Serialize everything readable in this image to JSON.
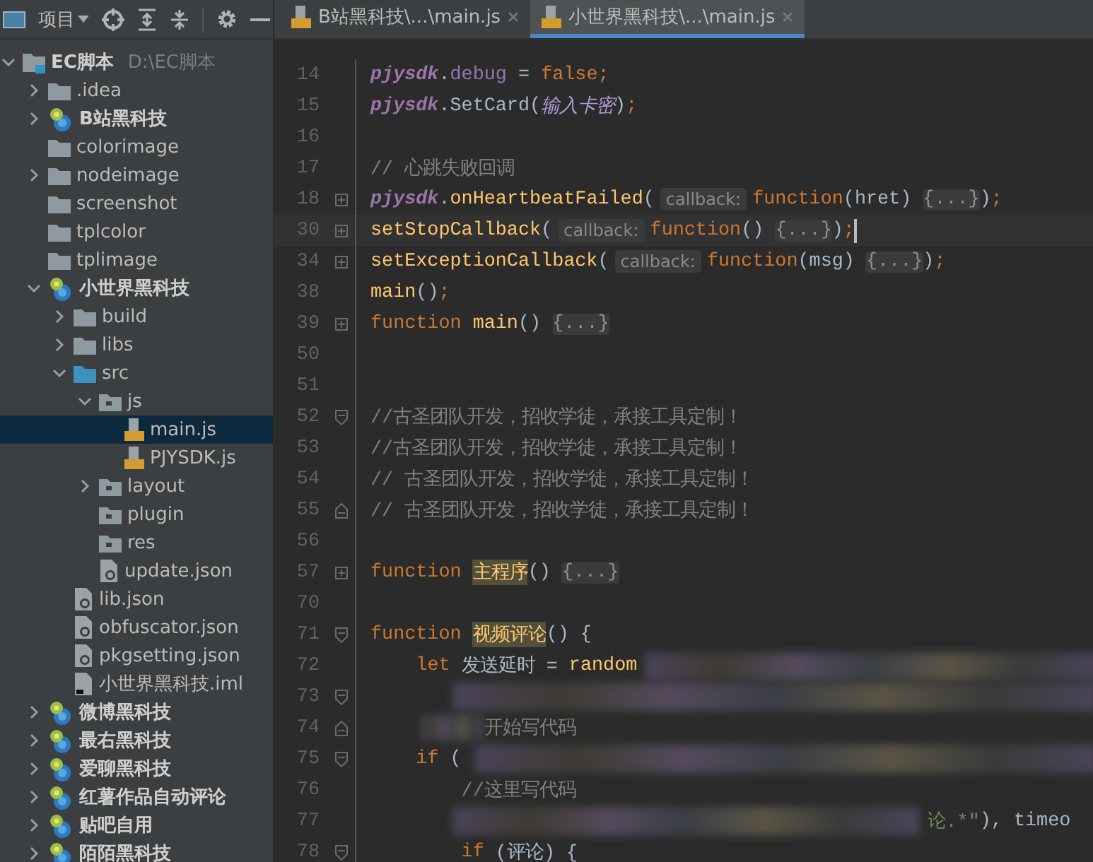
{
  "sidebar": {
    "toolbar": {
      "title": "项目"
    },
    "tree": [
      {
        "label": "EC脚本",
        "path": "D:\\EC脚本",
        "kind": "root",
        "expanded": true,
        "selected": false,
        "children": [
          {
            "label": ".idea",
            "kind": "folder",
            "expanded": false,
            "selected": false
          },
          {
            "label": "B站黑科技",
            "kind": "module",
            "expanded": false,
            "selected": false
          },
          {
            "label": "colorimage",
            "kind": "folder",
            "selected": false
          },
          {
            "label": "nodeimage",
            "kind": "folder",
            "expanded": false,
            "selected": false
          },
          {
            "label": "screenshot",
            "kind": "folder",
            "selected": false
          },
          {
            "label": "tplcolor",
            "kind": "folder",
            "selected": false
          },
          {
            "label": "tplimage",
            "kind": "folder",
            "selected": false
          },
          {
            "label": "小世界黑科技",
            "kind": "module",
            "expanded": true,
            "selected": false,
            "children": [
              {
                "label": "build",
                "kind": "folder",
                "expanded": false,
                "selected": false
              },
              {
                "label": "libs",
                "kind": "folder",
                "expanded": false,
                "selected": false
              },
              {
                "label": "src",
                "kind": "source",
                "expanded": true,
                "selected": false,
                "children": [
                  {
                    "label": "js",
                    "kind": "package",
                    "expanded": true,
                    "selected": false,
                    "children": [
                      {
                        "label": "main.js",
                        "kind": "js",
                        "selected": true
                      },
                      {
                        "label": "PJYSDK.js",
                        "kind": "js",
                        "selected": false
                      }
                    ]
                  },
                  {
                    "label": "layout",
                    "kind": "package",
                    "expanded": false,
                    "selected": false
                  },
                  {
                    "label": "plugin",
                    "kind": "package",
                    "selected": false
                  },
                  {
                    "label": "res",
                    "kind": "package",
                    "selected": false
                  },
                  {
                    "label": "update.json",
                    "kind": "json",
                    "selected": false
                  }
                ]
              },
              {
                "label": "lib.json",
                "kind": "json",
                "selected": false
              },
              {
                "label": "obfuscator.json",
                "kind": "json",
                "selected": false
              },
              {
                "label": "pkgsetting.json",
                "kind": "json",
                "selected": false
              },
              {
                "label": "小世界黑科技.iml",
                "kind": "iml",
                "selected": false
              }
            ]
          },
          {
            "label": "微博黑科技",
            "kind": "module",
            "expanded": false,
            "selected": false
          },
          {
            "label": "最右黑科技",
            "kind": "module",
            "expanded": false,
            "selected": false
          },
          {
            "label": "爱聊黑科技",
            "kind": "module",
            "expanded": false,
            "selected": false
          },
          {
            "label": "红薯作品自动评论",
            "kind": "module",
            "expanded": false,
            "selected": false
          },
          {
            "label": "贴吧自用",
            "kind": "module",
            "expanded": false,
            "selected": false
          },
          {
            "label": "陌陌黑科技",
            "kind": "module",
            "expanded": false,
            "selected": false
          }
        ]
      }
    ]
  },
  "tabs": [
    {
      "label": "B站黑科技\\...\\main.js",
      "selected": false
    },
    {
      "label": "小世界黑科技\\...\\main.js",
      "selected": true
    }
  ],
  "editor": {
    "redacted": true,
    "lines": [
      {
        "number": "14",
        "current": false,
        "tokens": [
          {
            "kind": "object",
            "text": "pjysdk"
          },
          {
            "kind": "plain",
            "text": "."
          },
          {
            "kind": "field",
            "text": "debug"
          },
          {
            "kind": "plain",
            "text": " = "
          },
          {
            "kind": "keyword",
            "text": "false;"
          }
        ]
      },
      {
        "number": "15",
        "current": false,
        "tokens": [
          {
            "kind": "object",
            "text": "pjysdk"
          },
          {
            "kind": "plain",
            "text": ".SetCard("
          },
          {
            "kind": "variable",
            "text": "输入卡密"
          },
          {
            "kind": "plain",
            "text": ")"
          },
          {
            "kind": "keyword",
            "text": ";"
          }
        ]
      },
      {
        "number": "16",
        "current": false
      },
      {
        "number": "17",
        "current": false,
        "tokens": [
          {
            "kind": "comment",
            "text": "// 心跳失败回调"
          }
        ]
      },
      {
        "number": "18",
        "current": false,
        "collapsed": true,
        "tokens": [
          {
            "kind": "object",
            "text": "pjysdk"
          },
          {
            "kind": "plain",
            "text": "."
          },
          {
            "kind": "function",
            "text": "onHeartbeatFailed"
          },
          {
            "kind": "plain",
            "text": "("
          },
          {
            "kind": "hint",
            "text": "callback:"
          },
          {
            "kind": "keyword",
            "text": "function"
          },
          {
            "kind": "plain",
            "text": "(hret) "
          },
          {
            "kind": "folded",
            "text": "{...}"
          },
          {
            "kind": "plain",
            "text": ")"
          },
          {
            "kind": "keyword",
            "text": ";"
          }
        ]
      },
      {
        "number": "30",
        "current": true,
        "collapsed": true,
        "tokens": [
          {
            "kind": "function",
            "text": "setStopCallback"
          },
          {
            "kind": "plain",
            "text": "("
          },
          {
            "kind": "hint",
            "text": "callback:"
          },
          {
            "kind": "keyword",
            "text": "function"
          },
          {
            "kind": "plain",
            "text": "() "
          },
          {
            "kind": "folded",
            "text": "{...}"
          },
          {
            "kind": "plain",
            "text": ")"
          },
          {
            "kind": "keyword",
            "text": ";"
          }
        ]
      },
      {
        "number": "34",
        "current": false,
        "collapsed": true,
        "tokens": [
          {
            "kind": "function",
            "text": "setExceptionCallback"
          },
          {
            "kind": "plain",
            "text": "("
          },
          {
            "kind": "hint",
            "text": "callback:"
          },
          {
            "kind": "keyword",
            "text": "function"
          },
          {
            "kind": "plain",
            "text": "(msg) "
          },
          {
            "kind": "folded",
            "text": "{...}"
          },
          {
            "kind": "plain",
            "text": ")"
          },
          {
            "kind": "keyword",
            "text": ";"
          }
        ]
      },
      {
        "number": "38",
        "current": false,
        "tokens": [
          {
            "kind": "function",
            "text": "main"
          },
          {
            "kind": "plain",
            "text": "()"
          },
          {
            "kind": "keyword",
            "text": ";"
          }
        ]
      },
      {
        "number": "39",
        "current": false,
        "collapsed": true,
        "tokens": [
          {
            "kind": "keyword",
            "text": "function "
          },
          {
            "kind": "function",
            "text": "main"
          },
          {
            "kind": "plain",
            "text": "() "
          },
          {
            "kind": "folded",
            "text": "{...}"
          }
        ]
      },
      {
        "number": "50",
        "current": false
      },
      {
        "number": "51",
        "current": false
      },
      {
        "number": "52",
        "current": false,
        "collapsed": false,
        "tokens": [
          {
            "kind": "comment",
            "text": "//古圣团队开发，招收学徒，承接工具定制！"
          }
        ]
      },
      {
        "number": "53",
        "current": false,
        "tokens": [
          {
            "kind": "comment",
            "text": "//古圣团队开发，招收学徒，承接工具定制！"
          }
        ]
      },
      {
        "number": "54",
        "current": false,
        "tokens": [
          {
            "kind": "comment",
            "text": "// 古圣团队开发，招收学徒，承接工具定制！"
          }
        ]
      },
      {
        "number": "55",
        "current": false,
        "fold_end": true,
        "tokens": [
          {
            "kind": "comment",
            "text": "// 古圣团队开发，招收学徒，承接工具定制！"
          }
        ]
      },
      {
        "number": "56",
        "current": false
      },
      {
        "number": "57",
        "current": false,
        "collapsed": true,
        "tokens": [
          {
            "kind": "keyword",
            "text": "function "
          },
          {
            "kind": "marked",
            "text": "主程序"
          },
          {
            "kind": "plain",
            "text": "() "
          },
          {
            "kind": "folded",
            "text": "{...}"
          }
        ]
      },
      {
        "number": "70",
        "current": false
      },
      {
        "number": "71",
        "current": false,
        "collapsed": false,
        "tokens": [
          {
            "kind": "keyword",
            "text": "function "
          },
          {
            "kind": "marked",
            "text": "视频评论"
          },
          {
            "kind": "plain",
            "text": "() {"
          }
        ]
      },
      {
        "number": "72",
        "current": false,
        "tokens": [
          {
            "kind": "keyword",
            "text": "    let "
          },
          {
            "kind": "plain",
            "text": "发送延时 = "
          },
          {
            "kind": "function",
            "text": "random"
          }
        ]
      },
      {
        "number": "73",
        "current": false,
        "collapsed": false
      },
      {
        "number": "74",
        "current": false,
        "fold_end": true,
        "tokens": [
          {
            "kind": "comment",
            "text": "          开始写代码"
          }
        ]
      },
      {
        "number": "75",
        "current": false,
        "collapsed": false,
        "tokens": [
          {
            "kind": "keyword",
            "text": "    if "
          },
          {
            "kind": "plain",
            "text": "("
          }
        ]
      },
      {
        "number": "76",
        "current": false,
        "tokens": [
          {
            "kind": "comment",
            "text": "        //这里写代码"
          }
        ]
      },
      {
        "number": "77",
        "current": false,
        "tokens": [
          {
            "kind": "string",
            "text": "                                                 论.*\""
          },
          {
            "kind": "plain",
            "text": "), timeo"
          }
        ]
      },
      {
        "number": "78",
        "current": false,
        "collapsed": false,
        "tokens": [
          {
            "kind": "keyword",
            "text": "        if "
          },
          {
            "kind": "plain",
            "text": "(评论) {"
          }
        ]
      }
    ]
  }
}
